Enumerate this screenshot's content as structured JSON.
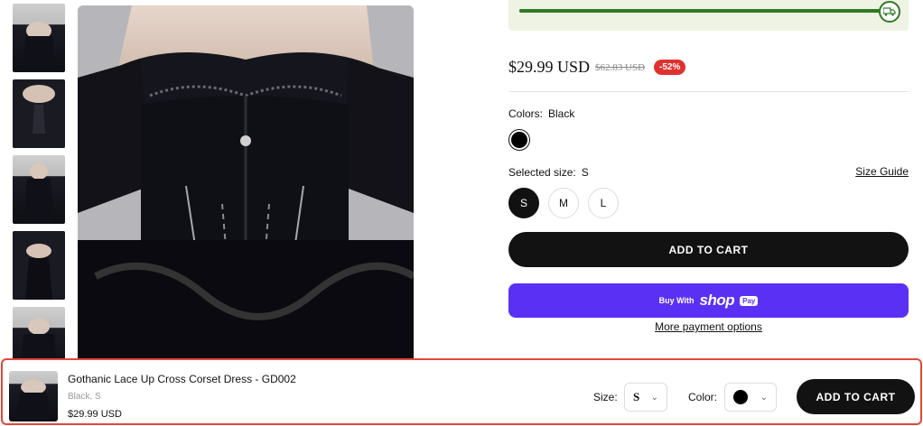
{
  "shipping_progress": {
    "percent": 100,
    "icon": "truck-icon",
    "accent_color": "#2f7a22"
  },
  "product": {
    "price": "$29.99 USD",
    "compare_price": "$62.83 USD",
    "discount_badge": "-52%",
    "colors_label": "Colors:",
    "selected_color": "Black",
    "color_swatches": [
      {
        "name": "Black",
        "hex": "#000000",
        "selected": true
      }
    ],
    "size_label": "Selected size:",
    "selected_size": "S",
    "size_guide": "Size Guide",
    "sizes": [
      "S",
      "M",
      "L"
    ],
    "add_to_cart": "ADD TO CART",
    "shop_pay": {
      "buy_with": "Buy With",
      "shop": "shop",
      "pay": "Pay"
    },
    "more_payment": "More payment options"
  },
  "sticky_bar": {
    "title": "Gothanic Lace Up Cross Corset Dress - GD002",
    "variant": "Black, S",
    "price": "$29.99 USD",
    "size_label": "Size:",
    "size_value": "S",
    "color_label": "Color:",
    "color_hex": "#000000",
    "add_to_cart": "ADD TO CART",
    "highlight_color": "#e04a3a"
  }
}
